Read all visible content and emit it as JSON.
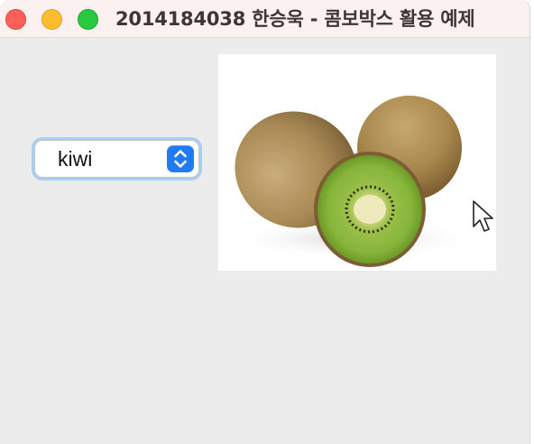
{
  "window": {
    "title": "2014184038 한승욱 - 콤보박스 활용 예제"
  },
  "combo_box": {
    "selected_value": "kiwi",
    "accent_color": "#1f7cf5"
  },
  "image": {
    "subject": "kiwi-fruit-image"
  },
  "colors": {
    "close": "#fe5f57",
    "minimize": "#febc2e",
    "zoom": "#28c840",
    "window_bg": "#ececec",
    "titlebar_bg": "#fbf1f1"
  }
}
